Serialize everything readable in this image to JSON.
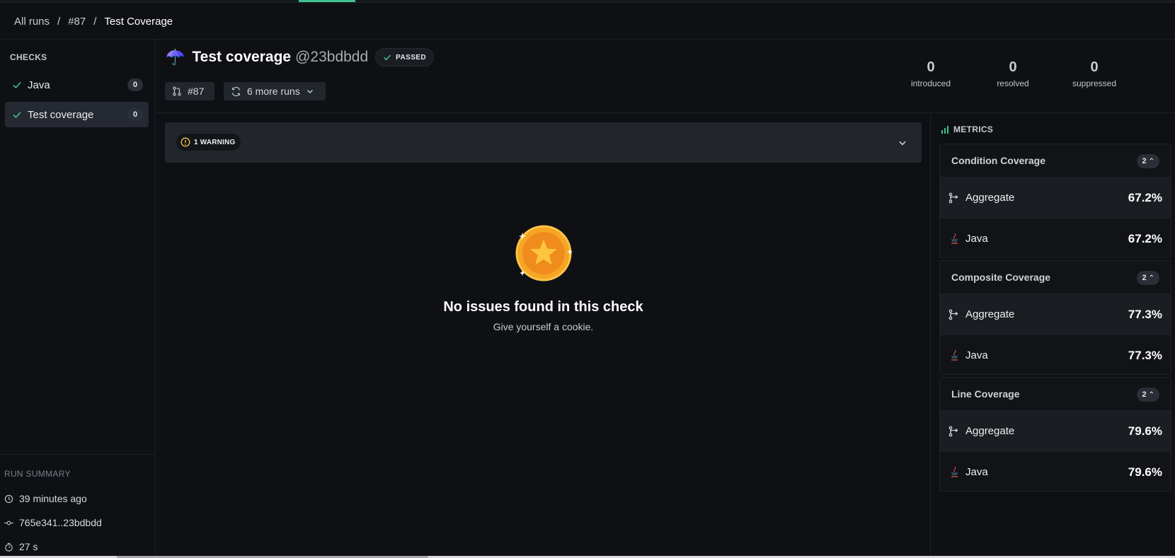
{
  "breadcrumb": {
    "items": [
      "All runs",
      "#87",
      "Test Coverage"
    ],
    "separator": "/"
  },
  "sidebar": {
    "title": "CHECKS",
    "checks": [
      {
        "label": "Java",
        "count": "0"
      },
      {
        "label": "Test coverage",
        "count": "0"
      }
    ],
    "run_summary": {
      "title": "RUN SUMMARY",
      "time_ago": "39 minutes ago",
      "commit_range": "765e341..23bdbdd",
      "duration": "27 s"
    }
  },
  "header": {
    "icon": "☂️",
    "title": "Test coverage",
    "sha": "@23bdbdd",
    "status": "PASSED",
    "run_chip": "#87",
    "more_runs": "6 more runs",
    "stats": [
      {
        "value": "0",
        "label": "introduced"
      },
      {
        "value": "0",
        "label": "resolved"
      },
      {
        "value": "0",
        "label": "suppressed"
      }
    ]
  },
  "warning": {
    "label": "1 WARNING"
  },
  "empty_state": {
    "headline": "No issues found in this check",
    "subtext": "Give yourself a cookie."
  },
  "metrics": {
    "title": "METRICS",
    "groups": [
      {
        "name": "Condition Coverage",
        "count": "2",
        "rows": [
          {
            "label": "Aggregate",
            "value": "67.2%"
          },
          {
            "label": "Java",
            "value": "67.2%"
          }
        ]
      },
      {
        "name": "Composite Coverage",
        "count": "2",
        "rows": [
          {
            "label": "Aggregate",
            "value": "77.3%"
          },
          {
            "label": "Java",
            "value": "77.3%"
          }
        ]
      },
      {
        "name": "Line Coverage",
        "count": "2",
        "rows": [
          {
            "label": "Aggregate",
            "value": "79.6%"
          },
          {
            "label": "Java",
            "value": "79.6%"
          }
        ]
      }
    ]
  },
  "colors": {
    "background": "#0e1014",
    "accent_green": "#3ec28f",
    "warning_yellow": "#f2c94c",
    "coin_orange": "#f5a623"
  }
}
